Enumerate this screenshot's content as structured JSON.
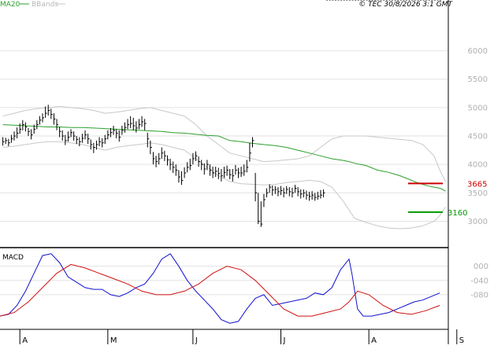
{
  "header": {
    "legend_ma": "MA20",
    "legend_bb": "BBands",
    "copyright": "© TEC 30/8/2026 3:1 GMT"
  },
  "colors": {
    "price": "#000000",
    "ma20": "#2ca02c",
    "bbands": "#c8c8c8",
    "macd": "#1010d0",
    "signal": "#d01010",
    "resistance": "#cc0000",
    "support": "#009900",
    "grid": "#e2e2e2",
    "axis_text": "#b0b0b0"
  },
  "chart_data": [
    {
      "type": "line",
      "title": "",
      "yticks": [
        "3000",
        "3500",
        "4000",
        "4500",
        "5000",
        "5500",
        "6000"
      ],
      "ylim": [
        2550,
        6700
      ],
      "xticks": [
        "A",
        "M",
        "J",
        "J",
        "A",
        "S"
      ],
      "xtick_days": [
        0,
        31,
        61,
        92,
        123,
        154
      ],
      "xlim": [
        -7,
        151
      ],
      "levels": [
        {
          "label": "3665",
          "value": 3665,
          "role": "resistance"
        },
        {
          "label": "3160",
          "value": 3160,
          "role": "support"
        }
      ],
      "price_days": [
        -6,
        -5,
        -4,
        -3,
        -2,
        -1,
        0,
        1,
        2,
        3,
        4,
        5,
        6,
        7,
        8,
        9,
        10,
        11,
        12,
        13,
        14,
        15,
        16,
        17,
        18,
        19,
        20,
        21,
        22,
        23,
        24,
        25,
        26,
        27,
        28,
        29,
        30,
        31,
        32,
        33,
        34,
        35,
        36,
        37,
        38,
        39,
        40,
        41,
        42,
        43,
        44,
        45,
        46,
        47,
        48,
        49,
        50,
        51,
        52,
        53,
        54,
        55,
        56,
        57,
        58,
        59,
        60,
        61,
        62,
        63,
        64,
        65,
        66,
        67,
        68,
        69,
        70,
        71,
        72,
        73,
        74,
        75,
        76,
        77,
        78,
        79,
        80,
        81,
        82,
        83,
        84,
        85,
        86,
        87,
        88,
        89,
        90,
        91,
        92,
        93,
        94,
        95,
        96,
        97,
        98,
        99,
        100,
        101,
        102,
        103,
        104,
        105,
        106,
        107,
        108,
        109,
        110,
        111,
        112,
        113,
        114,
        115,
        116,
        117,
        118,
        119,
        120,
        121,
        122,
        123,
        124,
        125,
        126,
        127,
        128,
        129,
        130,
        131,
        132,
        133,
        134,
        135,
        136,
        137,
        138,
        139,
        140,
        141,
        142,
        143,
        144,
        145,
        146,
        147,
        148
      ],
      "price_close": [
        4400,
        4420,
        4380,
        4450,
        4500,
        4550,
        4620,
        4700,
        4660,
        4580,
        4520,
        4620,
        4700,
        4780,
        4820,
        4900,
        4950,
        4880,
        4800,
        4700,
        4580,
        4500,
        4420,
        4480,
        4560,
        4500,
        4440,
        4400,
        4460,
        4520,
        4450,
        4350,
        4300,
        4350,
        4400,
        4380,
        4450,
        4520,
        4560,
        4600,
        4550,
        4480,
        4600,
        4650,
        4700,
        4720,
        4680,
        4640,
        4700,
        4750,
        4720,
        4450,
        4300,
        4100,
        4050,
        4100,
        4200,
        4150,
        4080,
        4000,
        3950,
        3900,
        3780,
        3720,
        3850,
        3950,
        3980,
        4100,
        4150,
        4050,
        4000,
        3920,
        4000,
        3900,
        3850,
        3880,
        3840,
        3800,
        3860,
        3900,
        3820,
        3800,
        3900,
        3850,
        3850,
        3880,
        3950,
        4200,
        4420,
        3500,
        3000,
        2950,
        3380,
        3500,
        3600,
        3550,
        3560,
        3520,
        3540,
        3500,
        3560,
        3520,
        3500,
        3580,
        3520,
        3480,
        3500,
        3460,
        3440,
        3460,
        3420,
        3440,
        3460,
        3500
      ],
      "price_high": [
        4480,
        4470,
        4450,
        4520,
        4580,
        4650,
        4720,
        4780,
        4740,
        4640,
        4620,
        4700,
        4780,
        4850,
        4900,
        5020,
        5050,
        4980,
        4900,
        4800,
        4660,
        4600,
        4520,
        4580,
        4620,
        4580,
        4500,
        4480,
        4540,
        4600,
        4540,
        4440,
        4380,
        4420,
        4480,
        4460,
        4520,
        4600,
        4640,
        4680,
        4620,
        4600,
        4680,
        4740,
        4800,
        4850,
        4820,
        4760,
        4800,
        4850,
        4800,
        4560,
        4420,
        4220,
        4150,
        4200,
        4300,
        4240,
        4160,
        4100,
        4050,
        4000,
        3900,
        3880,
        3950,
        4040,
        4100,
        4200,
        4230,
        4140,
        4080,
        4020,
        4080,
        4000,
        3960,
        3960,
        3940,
        3920,
        3960,
        3980,
        3920,
        3920,
        3990,
        3940,
        3960,
        4000,
        4080,
        4380,
        4480,
        3850,
        3500,
        3350,
        3480,
        3580,
        3650,
        3630,
        3620,
        3600,
        3620,
        3590,
        3620,
        3600,
        3590,
        3640,
        3600,
        3560,
        3560,
        3540,
        3520,
        3530,
        3500,
        3520,
        3550,
        3560
      ],
      "price_low": [
        4330,
        4360,
        4320,
        4380,
        4420,
        4460,
        4540,
        4600,
        4580,
        4500,
        4440,
        4540,
        4620,
        4700,
        4740,
        4820,
        4860,
        4800,
        4700,
        4600,
        4480,
        4420,
        4340,
        4400,
        4480,
        4420,
        4360,
        4320,
        4380,
        4440,
        4360,
        4260,
        4200,
        4260,
        4320,
        4300,
        4360,
        4440,
        4480,
        4520,
        4460,
        4400,
        4520,
        4560,
        4620,
        4640,
        4600,
        4560,
        4620,
        4660,
        4600,
        4300,
        4180,
        4000,
        3950,
        4000,
        4100,
        4060,
        3980,
        3900,
        3850,
        3800,
        3680,
        3640,
        3760,
        3860,
        3900,
        4000,
        4060,
        3960,
        3900,
        3820,
        3900,
        3800,
        3760,
        3780,
        3740,
        3700,
        3760,
        3800,
        3740,
        3700,
        3820,
        3760,
        3780,
        3800,
        3860,
        4050,
        4300,
        3350,
        2950,
        2900,
        3250,
        3420,
        3500,
        3450,
        3480,
        3440,
        3460,
        3420,
        3480,
        3440,
        3420,
        3500,
        3440,
        3400,
        3420,
        3380,
        3360,
        3380,
        3360,
        3380,
        3400,
        3420
      ],
      "ma20": [
        4700,
        4690,
        4680,
        4670,
        4660,
        4660,
        4650,
        4650,
        4640,
        4630,
        4620,
        4610,
        4600,
        4590,
        4580,
        4560,
        4550,
        4530,
        4510,
        4500,
        4420,
        4400,
        4370,
        4350,
        4330,
        4300,
        4250,
        4200,
        4150,
        4100,
        4070,
        4050,
        4020,
        4000,
        3980,
        3940,
        3900,
        3880,
        3860,
        3830,
        3800,
        3760,
        3720,
        3680,
        3650,
        3620,
        3600,
        3580,
        3560,
        3530
      ],
      "ma20_days": [
        -6,
        -2,
        2,
        6,
        10,
        14,
        18,
        22,
        26,
        30,
        34,
        38,
        42,
        46,
        50,
        54,
        58,
        62,
        66,
        70,
        74,
        78,
        82,
        86,
        90,
        94,
        98,
        102,
        106,
        110,
        114,
        116,
        118,
        120,
        122,
        124,
        126,
        128,
        130,
        132,
        134,
        136,
        138,
        140,
        142,
        144,
        146,
        148,
        149,
        150
      ],
      "bb_upper": [
        4850,
        4900,
        4950,
        4980,
        5000,
        5020,
        5000,
        4980,
        4950,
        4900,
        4920,
        4950,
        4980,
        5000,
        4950,
        4900,
        4850,
        4700,
        4500,
        4350,
        4200,
        4150,
        4100,
        4050,
        4060,
        4080,
        4100,
        4150,
        4300,
        4450,
        4500,
        4500,
        4500,
        4480,
        4460,
        4440,
        4420,
        4350,
        4150,
        3900,
        3700
      ],
      "bb_lower": [
        4300,
        4320,
        4350,
        4380,
        4400,
        4400,
        4380,
        4350,
        4300,
        4250,
        4300,
        4330,
        4350,
        4380,
        4350,
        4300,
        4250,
        4100,
        3950,
        3800,
        3700,
        3660,
        3650,
        3640,
        3650,
        3680,
        3700,
        3720,
        3700,
        3600,
        3350,
        3050,
        2980,
        2920,
        2880,
        2870,
        2880,
        2920,
        3000,
        3100,
        3250
      ],
      "bb_days": [
        -6,
        -2,
        2,
        6,
        10,
        14,
        18,
        22,
        26,
        30,
        34,
        38,
        42,
        46,
        50,
        54,
        58,
        62,
        66,
        70,
        74,
        78,
        82,
        86,
        90,
        94,
        98,
        102,
        106,
        110,
        114,
        118,
        122,
        126,
        130,
        134,
        138,
        142,
        146,
        148,
        150
      ]
    },
    {
      "type": "line",
      "title": "MACD",
      "yticks": [
        "000",
        "-040",
        "-080"
      ],
      "ytick_values": [
        0,
        -40,
        -80
      ],
      "ylim": [
        -175,
        50
      ],
      "xticks": [
        "A",
        "M",
        "J",
        "J",
        "A",
        "S"
      ],
      "xtick_days": [
        0,
        31,
        61,
        92,
        123,
        154
      ],
      "xlim": [
        -7,
        151
      ],
      "series": [
        {
          "key": "macd",
          "days": [
            -7,
            -4,
            -1,
            2,
            5,
            8,
            11,
            14,
            17,
            20,
            23,
            26,
            29,
            32,
            35,
            38,
            41,
            44,
            47,
            50,
            53,
            56,
            59,
            62,
            65,
            68,
            71,
            74,
            77,
            80,
            83,
            86,
            89,
            92,
            95,
            98,
            101,
            104,
            107,
            110,
            113,
            116,
            117,
            119,
            121,
            124,
            127,
            130,
            133,
            136,
            139,
            142,
            145,
            148
          ],
          "values": [
            -140,
            -135,
            -110,
            -70,
            -20,
            30,
            35,
            10,
            -30,
            -45,
            -60,
            -65,
            -65,
            -80,
            -85,
            -75,
            -60,
            -50,
            -20,
            20,
            35,
            0,
            -40,
            -70,
            -95,
            -120,
            -150,
            -160,
            -155,
            -120,
            -90,
            -80,
            -110,
            -105,
            -100,
            -95,
            -90,
            -75,
            -80,
            -60,
            -10,
            20,
            -20,
            -120,
            -140,
            -140,
            -135,
            -130,
            -120,
            -110,
            -100,
            -95,
            -85,
            -75
          ]
        },
        {
          "key": "signal",
          "days": [
            -7,
            -2,
            3,
            8,
            13,
            18,
            23,
            28,
            33,
            38,
            43,
            48,
            53,
            58,
            63,
            68,
            73,
            78,
            83,
            88,
            93,
            98,
            103,
            108,
            113,
            116,
            119,
            123,
            128,
            133,
            138,
            143,
            148
          ],
          "values": [
            -140,
            -130,
            -100,
            -60,
            -20,
            5,
            -5,
            -20,
            -35,
            -50,
            -70,
            -80,
            -80,
            -70,
            -50,
            -20,
            0,
            -10,
            -40,
            -80,
            -120,
            -140,
            -140,
            -130,
            -120,
            -100,
            -70,
            -80,
            -110,
            -130,
            -135,
            -125,
            -110
          ]
        }
      ]
    }
  ]
}
